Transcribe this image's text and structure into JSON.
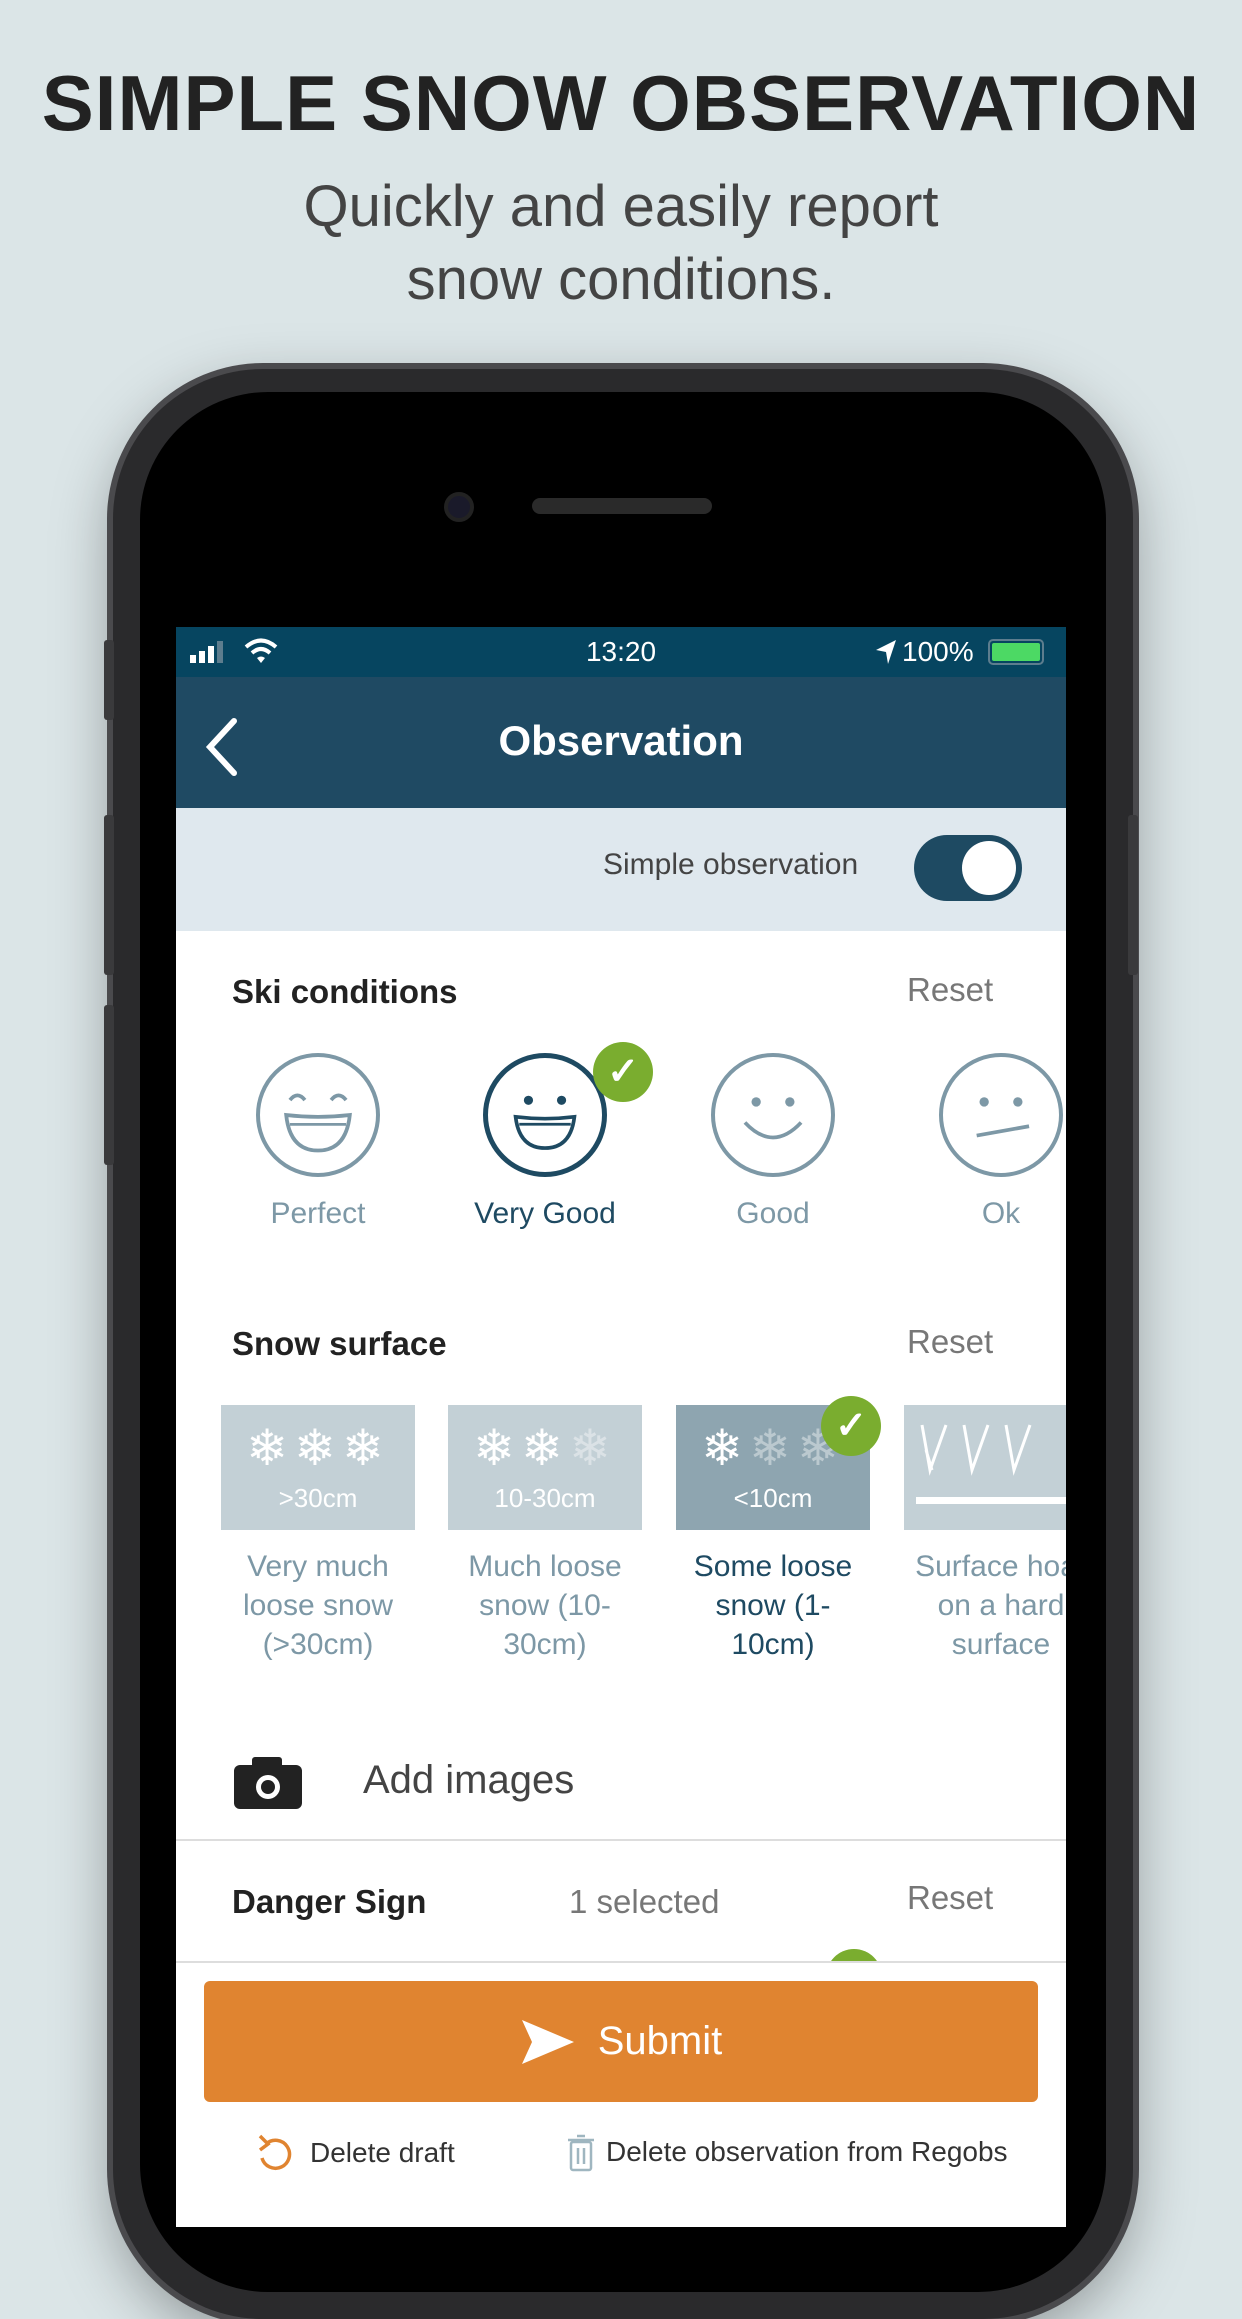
{
  "headline": {
    "title": "SIMPLE SNOW OBSERVATION",
    "subtitle_line1": "Quickly and easily report",
    "subtitle_line2": "snow conditions."
  },
  "status_bar": {
    "time": "13:20",
    "battery": "100%"
  },
  "nav": {
    "title": "Observation",
    "back_icon": "chevron-left-icon"
  },
  "simple_observation": {
    "label": "Simple observation",
    "enabled": true
  },
  "ski_conditions": {
    "title": "Ski conditions",
    "reset": "Reset",
    "options": [
      {
        "label": "Perfect",
        "selected": false
      },
      {
        "label": "Very Good",
        "selected": true
      },
      {
        "label": "Good",
        "selected": false
      },
      {
        "label": "Ok",
        "selected": false
      }
    ]
  },
  "snow_surface": {
    "title": "Snow surface",
    "reset": "Reset",
    "options": [
      {
        "tile": ">30cm",
        "line1": "Very much",
        "line2": "loose snow",
        "line3": "(>30cm)",
        "selected": false
      },
      {
        "tile": "10-30cm",
        "line1": "Much loose",
        "line2": "snow (10-",
        "line3": "30cm)",
        "selected": false
      },
      {
        "tile": "<10cm",
        "line1": "Some loose",
        "line2": "snow (1-",
        "line3": "10cm)",
        "selected": true
      },
      {
        "tile": "",
        "line1": "Surface hoar",
        "line2": "on a hard",
        "line3": "surface",
        "selected": false
      }
    ]
  },
  "add_images": {
    "label": "Add images"
  },
  "danger_sign": {
    "title": "Danger Sign",
    "count": "1 selected",
    "reset": "Reset"
  },
  "actions": {
    "submit": "Submit",
    "delete_draft": "Delete draft",
    "delete_observation": "Delete observation from Regobs"
  },
  "colors": {
    "nav": "#1f4a63",
    "status": "#064560",
    "accent": "#e08430",
    "check": "#7aad2f"
  }
}
